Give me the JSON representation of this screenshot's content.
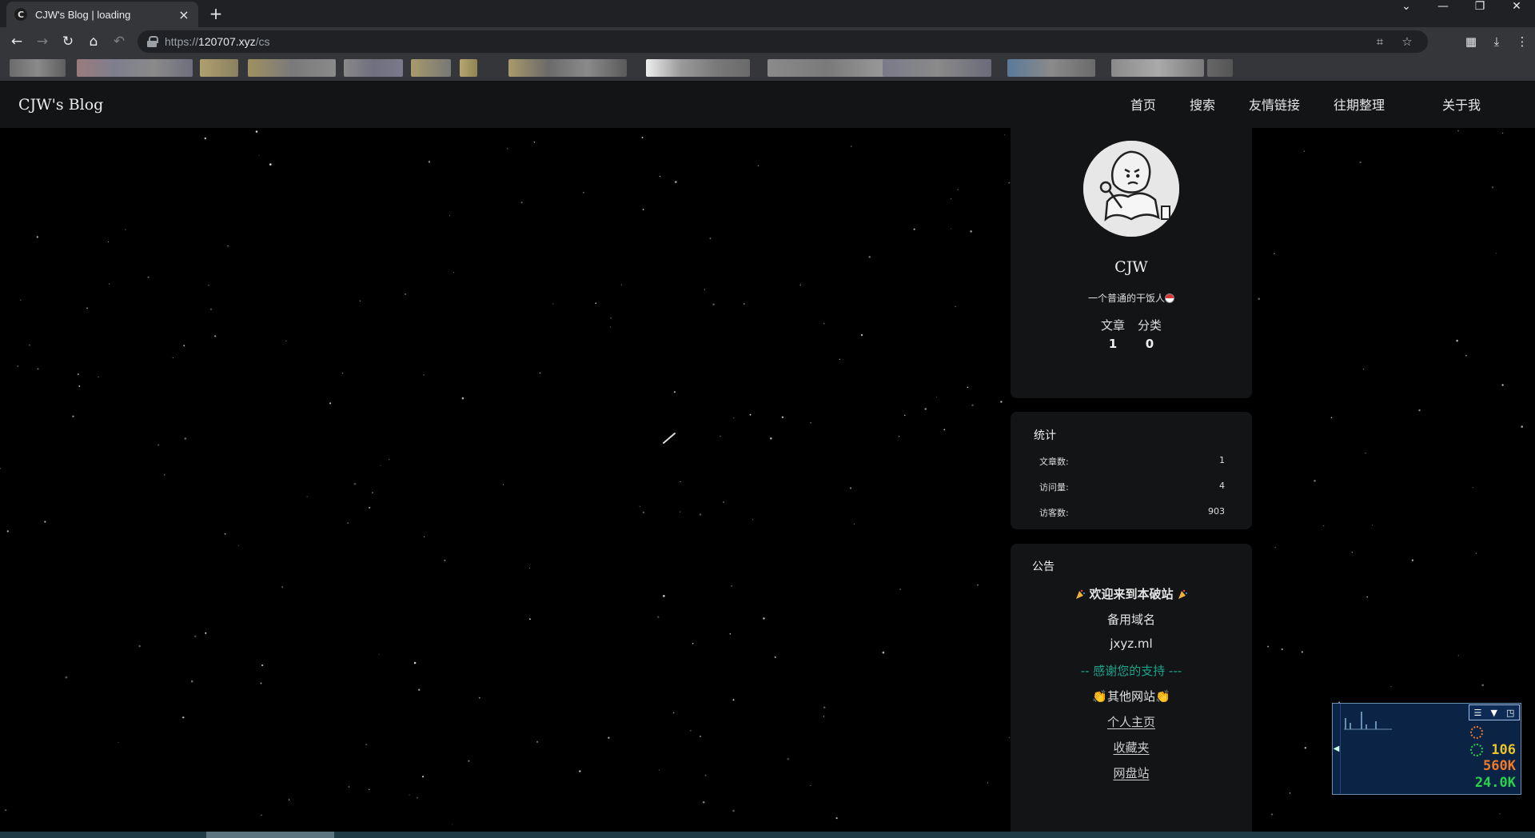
{
  "browser": {
    "tab_title": "CJW's Blog | loading",
    "tab_favicon_letter": "C",
    "url_scheme": "https://",
    "url_host": "120707.xyz",
    "url_path": "/cs"
  },
  "site": {
    "title": "CJW's Blog",
    "nav": [
      "首页",
      "搜索",
      "友情链接",
      "往期整理",
      "关于我"
    ]
  },
  "profile": {
    "name": "CJW",
    "motto": "一个普通的干饭人",
    "stats": [
      {
        "label": "文章",
        "value": "1"
      },
      {
        "label": "分类",
        "value": "0"
      }
    ]
  },
  "statistics": {
    "title": "统计",
    "rows": [
      {
        "label": "文章数:",
        "value": "1"
      },
      {
        "label": "访问量:",
        "value": "4"
      },
      {
        "label": "访客数:",
        "value": "903"
      }
    ]
  },
  "notice": {
    "title": "公告",
    "welcome": "欢迎来到本破站",
    "backup_label": "备用域名",
    "backup_domain": "jxyz.ml",
    "thanks": "-- 感谢您的支持 ---",
    "other_sites": "其他网站",
    "links": [
      "个人主页",
      "收藏夹",
      "网盘站"
    ]
  },
  "monitor": {
    "values": [
      "106",
      "560K",
      "24.0K"
    ],
    "colors": [
      "#e8c22a",
      "#ef7b2a",
      "#2ad24b"
    ]
  },
  "colors": {
    "header_bg": "#121416",
    "card_bg": "#121416",
    "accent_teal": "#1aa58e"
  }
}
